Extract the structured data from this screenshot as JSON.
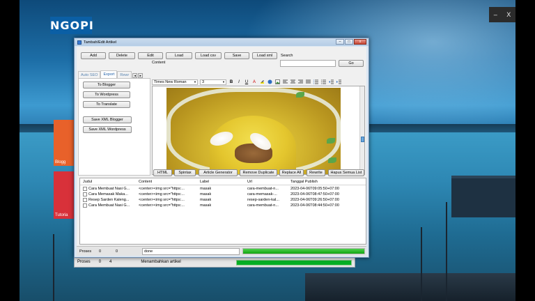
{
  "desktop": {
    "logo": "NGOPI",
    "tiles": [
      {
        "label": "Blogg"
      },
      {
        "label": "Tutoria"
      }
    ],
    "window_controls": {
      "minimize": "–",
      "close": "X"
    }
  },
  "window": {
    "title": "Tambah/Edit Artikel",
    "titlebar_buttons": {
      "minimize": "–",
      "maximize": "□",
      "close": "x"
    }
  },
  "toolbar": {
    "buttons": [
      "Add",
      "Delete",
      "Edit",
      "Load",
      "Load csv",
      "Save",
      "Load xml"
    ],
    "search_label": "Search",
    "search_value": "",
    "go_label": "Go"
  },
  "tabs": {
    "items": [
      "Auto SEO",
      "Export",
      "Rewr"
    ],
    "active": "Export",
    "scroll": [
      "◄",
      "►"
    ]
  },
  "export_panel": {
    "buttons": [
      "To Blogger",
      "To Wordpress",
      "To Translate",
      "Save XML Blogger",
      "Save XML Wordpress"
    ]
  },
  "editor": {
    "content_label": "Content",
    "font": "Times New Roman",
    "size": "3",
    "format_icons": [
      "B",
      "I",
      "U",
      "A"
    ]
  },
  "editor_actions": [
    "HTML",
    "Spintax",
    "Article Generator",
    "Remove Duplicate",
    "Replace All",
    "Rewrite",
    "Hapus Semua List"
  ],
  "grid": {
    "columns": [
      "Judul",
      "Content",
      "Label",
      "Url",
      "Tanggal Publish"
    ],
    "rows": [
      [
        "Cara Membuat Nasi G...",
        "<center><img src=\"https:...",
        "masak",
        "cara-membuat-n...",
        "2023-04-06T09:05:50+07:00"
      ],
      [
        "Cara Memasak Maka...",
        "<center><img src=\"https:...",
        "masak",
        "cara-memasak-...",
        "2023-04-06T08:47:50+07:00"
      ],
      [
        "Resep Sarden Kaleng...",
        "<center><img src=\"https:...",
        "masak",
        "resep-sarden-kal...",
        "2023-04-06T09:26:50+07:00"
      ],
      [
        "Cara Membuat Nasi G...",
        "<center><img src=\"https:...",
        "masak",
        "cara-membuat-n...",
        "2023-04-06T08:44:50+07:00"
      ]
    ]
  },
  "status": {
    "label": "Proses",
    "count1": "0",
    "count2": "0",
    "message": "done",
    "progress": 1.0
  },
  "back_status": {
    "label": "Proses",
    "count1": "0",
    "count2": "4",
    "message": "Menambahkan artikel"
  },
  "colors": {
    "progress": "#11a611",
    "tab_active": "#1f5fa8",
    "logo_bg": "#0b5fa5"
  }
}
